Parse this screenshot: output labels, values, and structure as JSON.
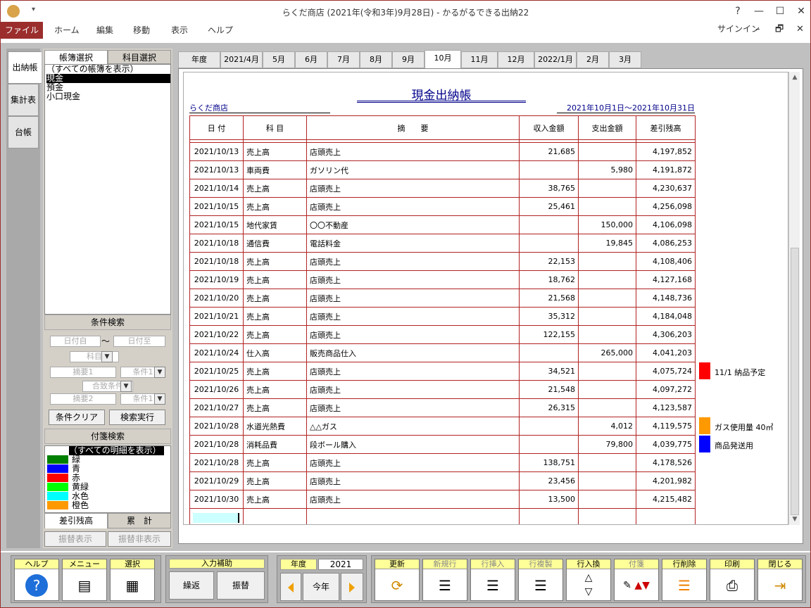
{
  "window": {
    "title": "らくだ商店 (2021年(令和3年)9月28日) - かるがるできる出納22",
    "help_glyph": "?",
    "min_glyph": "—",
    "max_glyph": "☐",
    "close_glyph": "✕",
    "qat": "▾"
  },
  "menu": {
    "file": "ファイル",
    "items": [
      "ホーム",
      "編集",
      "移動",
      "表示",
      "ヘルプ"
    ],
    "signin": "サインイン",
    "mdi_min": "–",
    "mdi_restore": "🗗",
    "mdi_close": "✕"
  },
  "vtabs": [
    "出納帳",
    "集計表",
    "台帳"
  ],
  "leftpanel": {
    "tabs": [
      "帳簿選択",
      "科目選択"
    ],
    "books": [
      "（すべての帳簿を表示）",
      "現金",
      "預金",
      "小口現金"
    ],
    "cond_title": "条件検索",
    "date_from": "日付自",
    "tilde": "〜",
    "date_to": "日付至",
    "subject": "科目",
    "summary1": "摘要1",
    "cond1": "条件1",
    "match": "合致条件",
    "summary2": "摘要2",
    "cond2": "条件1",
    "clear": "条件クリア",
    "run": "検索実行",
    "tag_title": "付箋検索",
    "tags": [
      {
        "label": "（すべての明細を表示）",
        "color": ""
      },
      {
        "label": "緑",
        "color": "#008000"
      },
      {
        "label": "青",
        "color": "#0000ff"
      },
      {
        "label": "赤",
        "color": "#ff0000"
      },
      {
        "label": "黄緑",
        "color": "#00ff00"
      },
      {
        "label": "水色",
        "color": "#00ffff"
      },
      {
        "label": "橙色",
        "color": "#ff9900"
      }
    ],
    "bottom_tabs": [
      "差引残高",
      "累　計"
    ],
    "transfer_show": "振替表示",
    "transfer_hide": "振替非表示"
  },
  "month_tabs": [
    "年度",
    "2021/4月",
    "5月",
    "6月",
    "7月",
    "8月",
    "9月",
    "10月",
    "11月",
    "12月",
    "2022/1月",
    "2月",
    "3月"
  ],
  "active_month": "10月",
  "ledger": {
    "title": "現金出納帳",
    "company": "らくだ商店",
    "period": "2021年10月1日〜2021年10月31日",
    "headers": [
      "日 付",
      "科 目",
      "摘　　要",
      "収入金額",
      "支出金額",
      "差引残高"
    ],
    "rows": [
      [
        "2021/10/13",
        "売上高",
        "店頭売上",
        "21,685",
        "",
        "4,197,852"
      ],
      [
        "2021/10/13",
        "車両費",
        "ガソリン代",
        "",
        "5,980",
        "4,191,872"
      ],
      [
        "2021/10/14",
        "売上高",
        "店頭売上",
        "38,765",
        "",
        "4,230,637"
      ],
      [
        "2021/10/15",
        "売上高",
        "店頭売上",
        "25,461",
        "",
        "4,256,098"
      ],
      [
        "2021/10/15",
        "地代家賃",
        "〇〇不動産",
        "",
        "150,000",
        "4,106,098"
      ],
      [
        "2021/10/18",
        "通信費",
        "電話料金",
        "",
        "19,845",
        "4,086,253"
      ],
      [
        "2021/10/18",
        "売上高",
        "店頭売上",
        "22,153",
        "",
        "4,108,406"
      ],
      [
        "2021/10/19",
        "売上高",
        "店頭売上",
        "18,762",
        "",
        "4,127,168"
      ],
      [
        "2021/10/20",
        "売上高",
        "店頭売上",
        "21,568",
        "",
        "4,148,736"
      ],
      [
        "2021/10/21",
        "売上高",
        "店頭売上",
        "35,312",
        "",
        "4,184,048"
      ],
      [
        "2021/10/22",
        "売上高",
        "店頭売上",
        "122,155",
        "",
        "4,306,203"
      ],
      [
        "2021/10/24",
        "仕入高",
        "販売商品仕入",
        "",
        "265,000",
        "4,041,203"
      ],
      [
        "2021/10/25",
        "売上高",
        "店頭売上",
        "34,521",
        "",
        "4,075,724"
      ],
      [
        "2021/10/26",
        "売上高",
        "店頭売上",
        "21,548",
        "",
        "4,097,272"
      ],
      [
        "2021/10/27",
        "売上高",
        "店頭売上",
        "26,315",
        "",
        "4,123,587"
      ],
      [
        "2021/10/28",
        "水道光熱費",
        "△△ガス",
        "",
        "4,012",
        "4,119,575"
      ],
      [
        "2021/10/28",
        "消耗品費",
        "段ボール購入",
        "",
        "79,800",
        "4,039,775"
      ],
      [
        "2021/10/28",
        "売上高",
        "店頭売上",
        "138,751",
        "",
        "4,178,526"
      ],
      [
        "2021/10/29",
        "売上高",
        "店頭売上",
        "23,456",
        "",
        "4,201,982"
      ],
      [
        "2021/10/30",
        "売上高",
        "店頭売上",
        "13,500",
        "",
        "4,215,482"
      ]
    ],
    "notes": [
      {
        "row": 12,
        "color": "#ff0000",
        "text": "11/1 納品予定"
      },
      {
        "row": 15,
        "color": "#ff9900",
        "text": "ガス使用量 40㎥"
      },
      {
        "row": 16,
        "color": "#0000ff",
        "text": "商品発送用"
      }
    ]
  },
  "toolbar": {
    "help": "ヘルプ",
    "menu": "メニュー",
    "select": "選択",
    "input_assist": "入力補助",
    "repeat": "繰返",
    "transfer": "振替",
    "year_label": "年度",
    "year_value": "2021",
    "this_year": "今年",
    "update": "更新",
    "new_row": "新規行",
    "insert_row": "行挿入",
    "copy_row": "行複製",
    "swap_row": "行入換",
    "tag": "付箋",
    "delete_row": "行削除",
    "print": "印刷",
    "close": "閉じる"
  }
}
